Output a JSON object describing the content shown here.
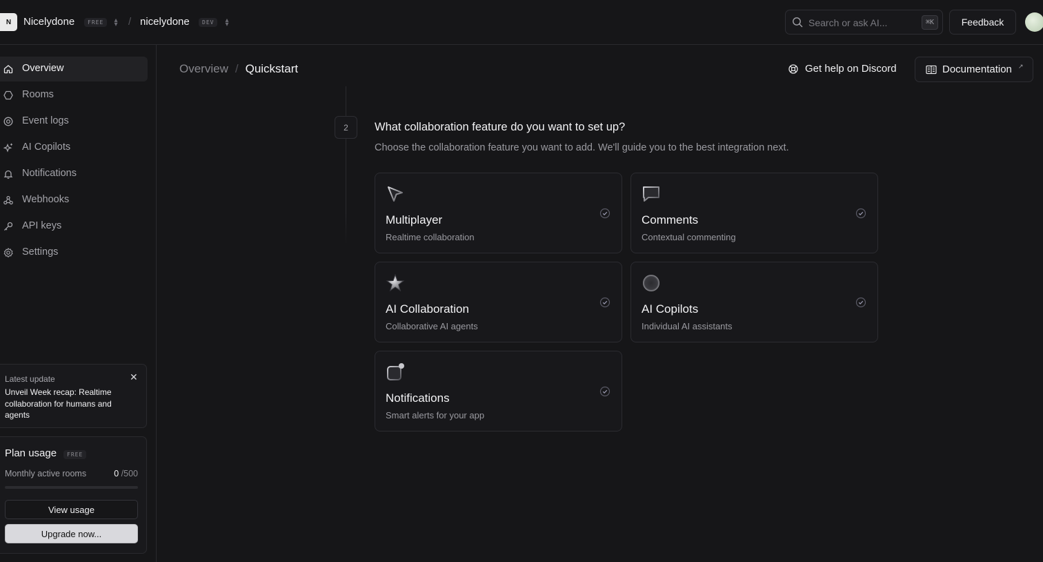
{
  "topbar": {
    "workspace_initial": "N",
    "workspace_name": "Nicelydone",
    "workspace_plan": "FREE",
    "separator": "/",
    "project_name": "nicelydone",
    "project_env": "DEV",
    "search_placeholder": "Search or ask AI...",
    "search_shortcut": "⌘K",
    "feedback_label": "Feedback"
  },
  "sidebar": {
    "items": [
      {
        "label": "Overview",
        "icon": "home-icon",
        "active": true
      },
      {
        "label": "Rooms",
        "icon": "hexagon-icon"
      },
      {
        "label": "Event logs",
        "icon": "target-icon"
      },
      {
        "label": "AI Copilots",
        "icon": "sparkle-icon"
      },
      {
        "label": "Notifications",
        "icon": "bell-icon"
      },
      {
        "label": "Webhooks",
        "icon": "webhook-icon"
      },
      {
        "label": "API keys",
        "icon": "key-icon"
      },
      {
        "label": "Settings",
        "icon": "gear-icon"
      }
    ],
    "update": {
      "label": "Latest update",
      "title": "Unveil Week recap: Realtime collaboration for humans and agents",
      "close": "✕"
    },
    "usage": {
      "title": "Plan usage",
      "plan": "FREE",
      "metric_label": "Monthly active rooms",
      "metric_value": "0",
      "metric_max": "/500",
      "progress": 0,
      "view_label": "View usage",
      "upgrade_label": "Upgrade now..."
    }
  },
  "header": {
    "breadcrumb_parent": "Overview",
    "breadcrumb_sep": "/",
    "breadcrumb_current": "Quickstart",
    "discord_label": "Get help on Discord",
    "docs_label": "Documentation",
    "docs_ext": "↗"
  },
  "step": {
    "number": "2",
    "title": "What collaboration feature do you want to set up?",
    "subtitle": "Choose the collaboration feature you want to add. We'll guide you to the best integration next."
  },
  "features": [
    {
      "title": "Multiplayer",
      "desc": "Realtime collaboration",
      "icon": "cursor-icon"
    },
    {
      "title": "Comments",
      "desc": "Contextual commenting",
      "icon": "comment-icon"
    },
    {
      "title": "AI Collaboration",
      "desc": "Collaborative AI agents",
      "icon": "star-icon"
    },
    {
      "title": "AI Copilots",
      "desc": "Individual AI assistants",
      "icon": "orb-icon"
    },
    {
      "title": "Notifications",
      "desc": "Smart alerts for your app",
      "icon": "notification-icon"
    }
  ],
  "colors": {
    "background": "#161618",
    "border": "#2a2a2e",
    "text": "#f3f3f5",
    "muted": "#9a9aa0"
  }
}
